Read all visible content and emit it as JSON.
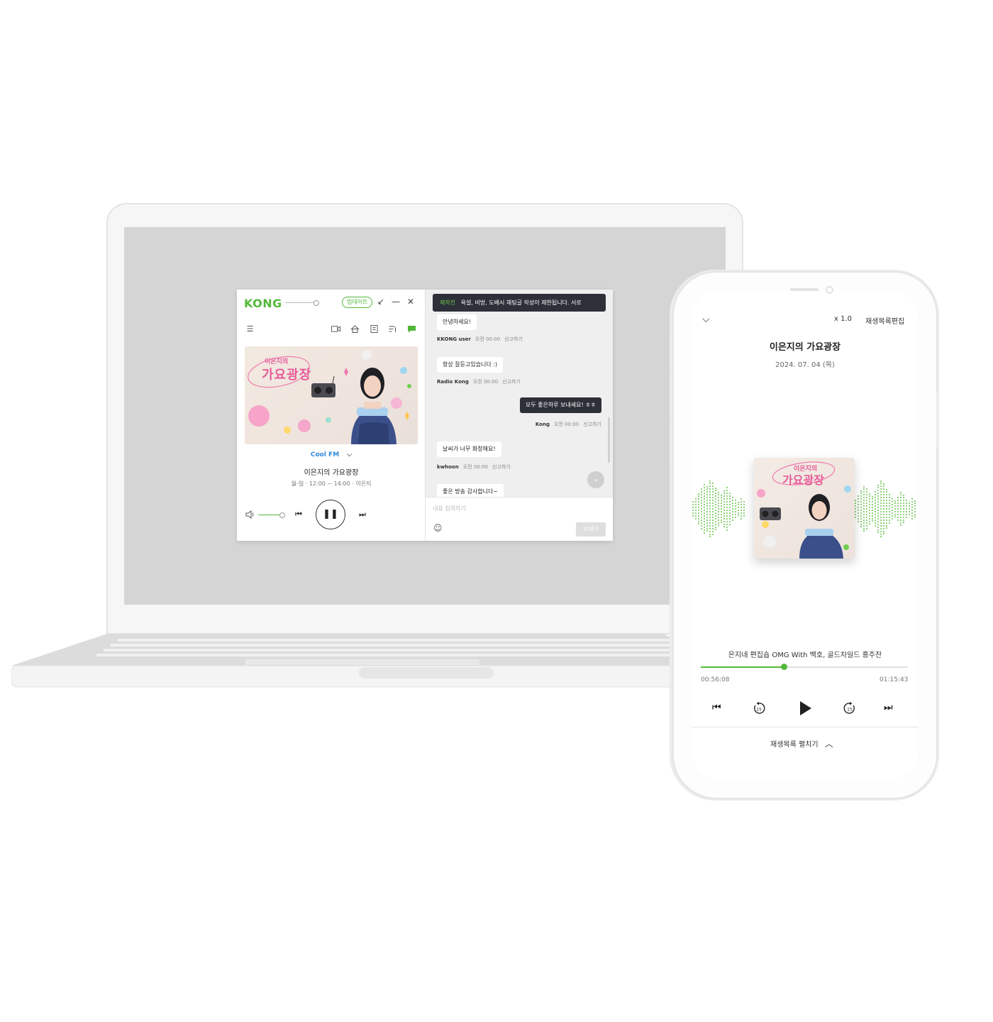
{
  "desktop_app": {
    "logo": "KONG",
    "update_label": "업데이트",
    "window_buttons": {
      "minimize_to_mini": "↙",
      "minimize": "—",
      "close": "✕"
    },
    "toolbar_icons": [
      "menu-icon",
      "video-icon",
      "home-icon",
      "schedule-icon",
      "playlist-icon",
      "chat-icon"
    ],
    "album_title": "이은지의 가요광장",
    "channel": "Cool FM",
    "program_title": "이은지의 가요광장",
    "program_schedule": "월-일 · 12:00 ~ 14:00 · 이은지",
    "volume_level": 0.9,
    "chat": {
      "notice_tag": "제작진",
      "notice_text": "욕설, 비방, 도배시 채팅글 작성이 제한됩니다. 서로",
      "messages": [
        {
          "text": "안녕하세요!",
          "user": "KKONG user",
          "time": "오전 00:00",
          "report": "신고하기",
          "mine": false
        },
        {
          "text": "항상 잘듣고있습니다 :)",
          "user": "Radio Kong",
          "time": "오전 00:00",
          "report": "신고하기",
          "mine": false
        },
        {
          "text": "모두 좋은하루 보내세요! ㅎㅎ",
          "user": "Kong",
          "time": "오전 00:00",
          "report": "신고하기",
          "mine": true
        },
        {
          "text": "날씨가 너무 화창해요!",
          "user": "kwhoon",
          "time": "오전 00:00",
          "report": "신고하기",
          "mine": false
        },
        {
          "text": "좋은 방송 감사합니다~",
          "user": "",
          "time": "",
          "report": "",
          "mine": false
        }
      ],
      "input_placeholder": "내용 입력하기",
      "send_label": "보내기"
    }
  },
  "mobile_app": {
    "speed_label": "x 1.0",
    "edit_playlist_label": "재생목록편집",
    "program_title": "이은지의 가요광장",
    "date": "2024. 07. 04 (목)",
    "track_title": "은지네 편집숍 OMG With 백호, 골드차일드 홍주찬",
    "elapsed": "00:56:08",
    "duration": "01:15:43",
    "progress": 0.4,
    "skip_back_seconds": "15",
    "skip_forward_seconds": "15",
    "expand_playlist_label": "재생목록 펼치기"
  },
  "colors": {
    "accent": "#53b839",
    "chat_dark": "#2d3038",
    "channel_blue": "#2f8ad8"
  }
}
